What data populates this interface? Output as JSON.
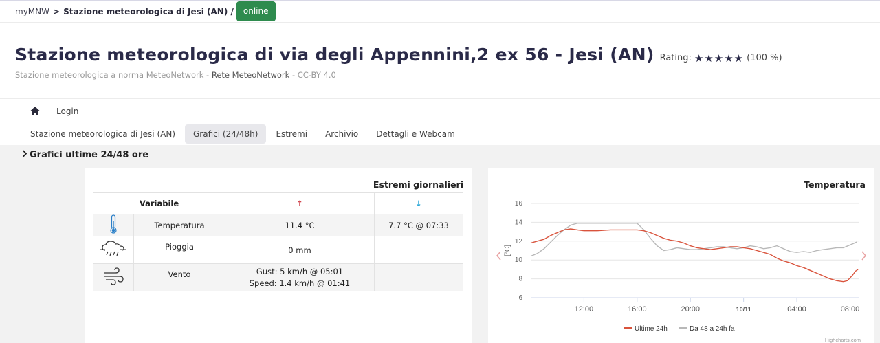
{
  "breadcrumb": {
    "home": "myMNW",
    "separator": ">",
    "current": "Stazione meteorologica di Jesi (AN) /",
    "status": "online"
  },
  "header": {
    "title": "Stazione meteorologica di via degli Appennini,2 ex 56 - Jesi (AN)",
    "rating_label": "Rating:",
    "rating_stars": 5,
    "rating_percent": "(100 %)",
    "subtitle_part1": "Stazione meteorologica a norma MeteoNetwork - ",
    "subtitle_part2": "Rete MeteoNetwork",
    "subtitle_part3": " - CC-BY 4.0"
  },
  "nav": {
    "login": "Login",
    "tabs": [
      {
        "label": "Stazione meteorologica di Jesi (AN)",
        "active": false
      },
      {
        "label": "Grafici (24/48h)",
        "active": true
      },
      {
        "label": "Estremi",
        "active": false
      },
      {
        "label": "Archivio",
        "active": false
      },
      {
        "label": "Dettagli e Webcam",
        "active": false
      }
    ]
  },
  "section": {
    "title": "Grafici ultime 24/48 ore"
  },
  "estremi": {
    "title": "Estremi giornalieri",
    "header_variable": "Variabile",
    "header_max_icon": "↑",
    "header_min_icon": "↓",
    "rows": [
      {
        "icon": "thermometer-icon",
        "name": "Temperatura",
        "max": "11.4 °C",
        "min": "7.7 °C @ 07:33"
      },
      {
        "icon": "rain-cloud-icon",
        "name": "Pioggia",
        "max": "0 mm",
        "min": ""
      },
      {
        "icon": "wind-icon",
        "name": "Vento",
        "max_line1": "Gust: 5 km/h @ 05:01",
        "max_line2": "Speed: 1.4 km/h @ 01:41",
        "min": ""
      }
    ]
  },
  "chart_data": {
    "type": "line",
    "title": "Temperatura",
    "xlabel": "",
    "ylabel": "[°C]",
    "ylim": [
      6,
      16
    ],
    "yticks": [
      6,
      8,
      10,
      12,
      14,
      16
    ],
    "xtick_labels": [
      "12:00",
      "16:00",
      "20:00",
      "10/11",
      "04:00",
      "08:00"
    ],
    "xtick_hours": [
      12,
      16,
      20,
      24,
      28,
      32
    ],
    "xlim": [
      8.0,
      32.7
    ],
    "grid": true,
    "legend_position": "bottom",
    "credit": "Highcharts.com",
    "colors": {
      "series1": "#d9533c",
      "series2": "#b8b8b8"
    },
    "series": [
      {
        "name": "Ultime 24h",
        "x": [
          8.0,
          8.5,
          9.0,
          9.5,
          10.0,
          10.5,
          11.0,
          11.5,
          12.0,
          13.0,
          14.0,
          15.0,
          16.0,
          16.5,
          17.0,
          17.5,
          18.0,
          18.5,
          19.0,
          19.5,
          20.0,
          20.5,
          21.0,
          21.5,
          22.0,
          22.5,
          23.0,
          23.5,
          24.0,
          24.5,
          25.0,
          25.5,
          26.0,
          26.5,
          27.0,
          27.5,
          28.0,
          28.5,
          29.0,
          29.5,
          30.0,
          30.5,
          31.0,
          31.5,
          31.8,
          32.0,
          32.2,
          32.4,
          32.6
        ],
        "values": [
          11.8,
          12.0,
          12.2,
          12.6,
          12.9,
          13.2,
          13.3,
          13.2,
          13.1,
          13.1,
          13.2,
          13.2,
          13.2,
          13.1,
          12.9,
          12.6,
          12.3,
          12.1,
          12.0,
          11.8,
          11.5,
          11.3,
          11.2,
          11.1,
          11.2,
          11.3,
          11.4,
          11.4,
          11.3,
          11.2,
          11.0,
          10.8,
          10.6,
          10.2,
          9.9,
          9.7,
          9.4,
          9.2,
          8.9,
          8.6,
          8.3,
          8.0,
          7.8,
          7.7,
          7.8,
          8.1,
          8.4,
          8.8,
          9.0
        ]
      },
      {
        "name": "Da 48 a 24h fa",
        "x": [
          8.0,
          8.5,
          9.0,
          9.5,
          10.0,
          10.5,
          11.0,
          11.5,
          12.0,
          13.0,
          14.0,
          15.0,
          16.0,
          16.5,
          17.0,
          17.5,
          18.0,
          18.5,
          19.0,
          19.5,
          20.0,
          20.5,
          21.0,
          21.5,
          22.0,
          22.5,
          23.0,
          23.5,
          24.0,
          24.5,
          25.0,
          25.5,
          26.0,
          26.5,
          27.0,
          27.5,
          28.0,
          28.5,
          29.0,
          29.5,
          30.0,
          30.5,
          31.0,
          31.5,
          32.0,
          32.5
        ],
        "values": [
          10.4,
          10.7,
          11.2,
          11.9,
          12.6,
          13.2,
          13.7,
          13.9,
          13.9,
          13.9,
          13.9,
          13.9,
          13.9,
          13.2,
          12.3,
          11.5,
          11.0,
          11.1,
          11.3,
          11.2,
          11.1,
          11.1,
          11.2,
          11.3,
          11.4,
          11.4,
          11.3,
          11.2,
          11.3,
          11.5,
          11.4,
          11.2,
          11.3,
          11.5,
          11.2,
          10.9,
          10.8,
          10.9,
          10.8,
          11.0,
          11.1,
          11.2,
          11.3,
          11.3,
          11.6,
          11.9
        ]
      }
    ]
  }
}
